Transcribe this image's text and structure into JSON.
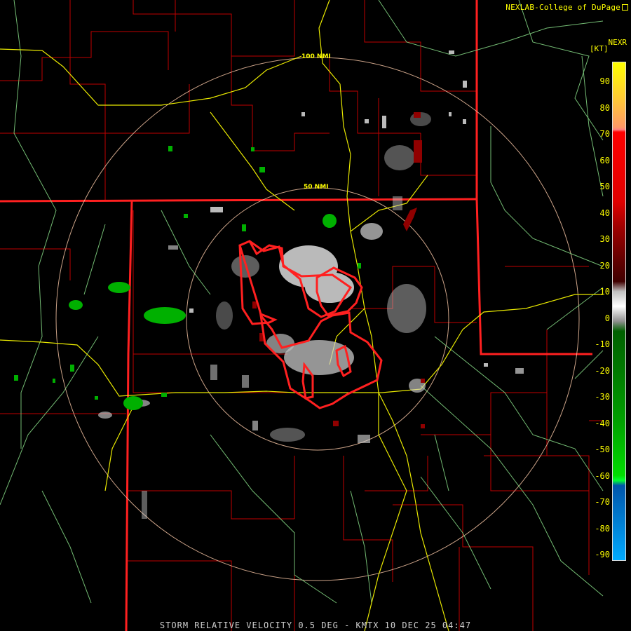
{
  "credit": "NEXLAB-College of DuPage",
  "scale": {
    "product": "NEXR",
    "units": "[KT]",
    "labels": [
      "90",
      "80",
      "70",
      "60",
      "50",
      "40",
      "30",
      "20",
      "10",
      "0",
      "-10",
      "-20",
      "-30",
      "-40",
      "-50",
      "-60",
      "-70",
      "-80",
      "-90"
    ]
  },
  "rings": {
    "inner": "50 NMI",
    "outer": "100 NMI"
  },
  "footer": "STORM RELATIVE VELOCITY 0.5 DEG - KMTX 10 DEC 25 04:47",
  "colors": {
    "background": "#000000",
    "state_border": "#ff2020",
    "county_border": "#c00000",
    "highway": "#e8e800",
    "road": "#80d080",
    "range_ring": "#f0c0a0",
    "warning_polygon": "#ff2020",
    "inbound_velocity": "#00c000",
    "outbound_velocity": "#b00000",
    "near_zero_velocity": "#d0d0d0"
  }
}
